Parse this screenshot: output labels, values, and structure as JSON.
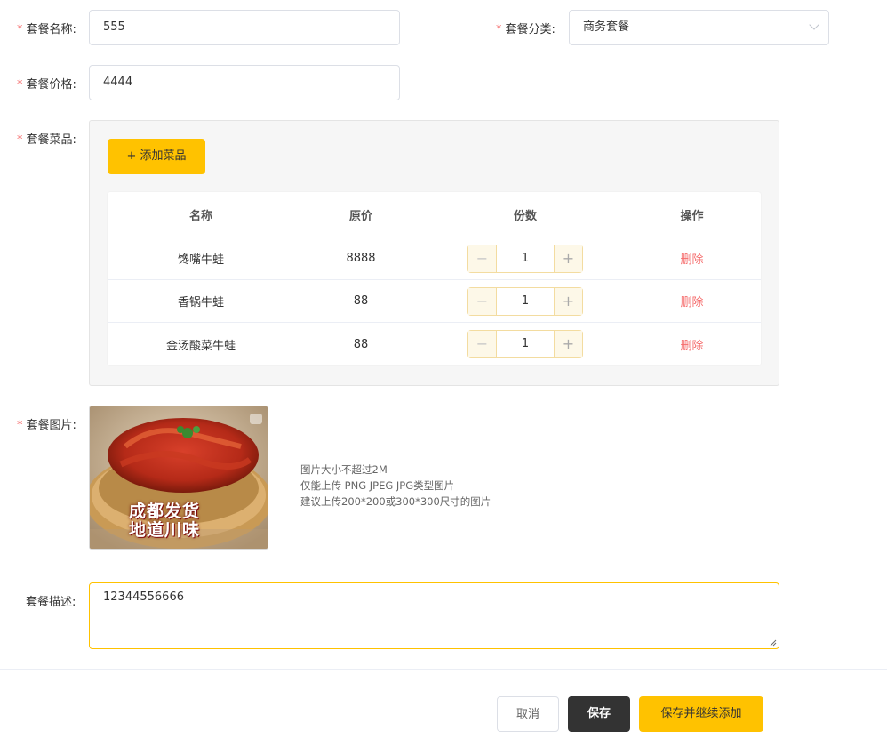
{
  "form": {
    "name_label": "套餐名称:",
    "name_value": "555",
    "category_label": "套餐分类:",
    "category_value": "商务套餐",
    "price_label": "套餐价格:",
    "price_value": "4444",
    "dishes_label": "套餐菜品:",
    "add_dish_button": "+ 添加菜品",
    "table": {
      "headers": [
        "名称",
        "原价",
        "份数",
        "操作"
      ],
      "rows": [
        {
          "name": "馋嘴牛蛙",
          "price": "8888",
          "qty": "1",
          "action": "删除"
        },
        {
          "name": "香锅牛蛙",
          "price": "88",
          "qty": "1",
          "action": "删除"
        },
        {
          "name": "金汤酸菜牛蛙",
          "price": "88",
          "qty": "1",
          "action": "删除"
        }
      ]
    },
    "image_label": "套餐图片:",
    "image_caption_line1": "成都发货",
    "image_caption_line2": "地道川味",
    "image_tips": [
      "图片大小不超过2M",
      "仅能上传 PNG JPEG JPG类型图片",
      "建议上传200*200或300*300尺寸的图片"
    ],
    "desc_label": "套餐描述:",
    "desc_value": "12344556666"
  },
  "footer": {
    "cancel": "取消",
    "save": "保存",
    "save_continue": "保存并继续添加"
  },
  "colors": {
    "accent": "#ffc200",
    "required": "#f56c6c",
    "dark_button": "#333333"
  }
}
